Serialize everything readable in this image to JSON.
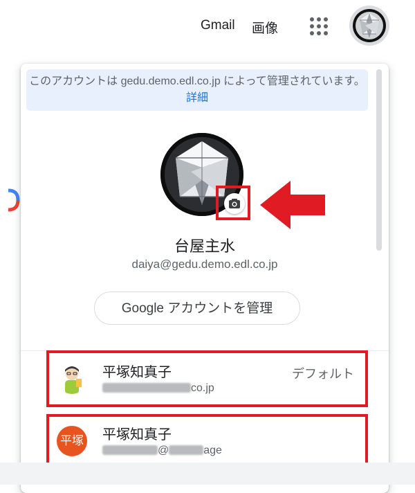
{
  "header": {
    "gmail_label": "Gmail",
    "images_label": "画像",
    "apps_icon": "apps-grid-icon",
    "avatar_icon": "diamond-avatar"
  },
  "popup": {
    "managed_notice": "このアカウントは gedu.demo.edl.co.jp によって管理されています。",
    "managed_detail_link": "詳細",
    "profile": {
      "avatar_icon": "diamond-avatar",
      "camera_icon": "camera-icon",
      "name": "台屋主水",
      "email": "daiya@gedu.demo.edl.co.jp"
    },
    "manage_account_button": "Google アカウントを管理",
    "accounts": [
      {
        "name": "平塚知真子",
        "email_visible_suffix": "co.jp",
        "badge": "デフォルト",
        "avatar_icon": "cartoon-avatar"
      },
      {
        "name": "平塚知真子",
        "email_visible_middle": "@",
        "email_visible_suffix": "age",
        "avatar_initials": "平塚"
      }
    ]
  },
  "annotation_colors": {
    "highlight_red": "#e01b24",
    "banner_bg": "#e8f0fe",
    "link_blue": "#1a73e8"
  }
}
